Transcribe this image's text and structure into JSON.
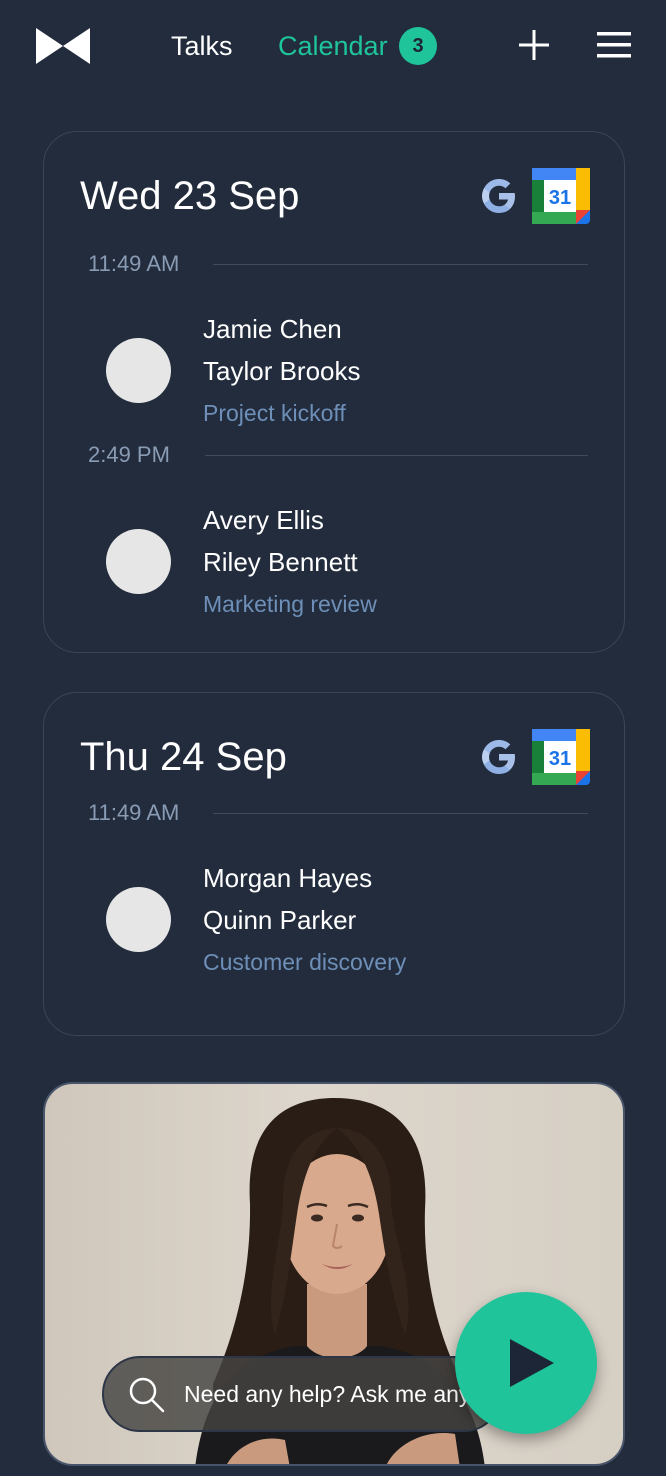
{
  "header": {
    "nav_talks": "Talks",
    "nav_calendar": "Calendar",
    "calendar_badge": "3",
    "logo_icon": "bowtie-logo-icon",
    "add_icon": "plus-icon",
    "menu_icon": "hamburger-menu-icon"
  },
  "days": [
    {
      "date": "Wed 23 Sep",
      "meetings": [
        {
          "time": "11:49 AM",
          "people": [
            "Jamie Chen",
            "Taylor Brooks"
          ],
          "title": "Project kickoff"
        },
        {
          "time": "2:49 PM",
          "people": [
            "Avery Ellis",
            "Riley Bennett"
          ],
          "title": "Marketing review"
        }
      ]
    },
    {
      "date": "Thu 24 Sep",
      "meetings": [
        {
          "time": "11:49 AM",
          "people": [
            "Morgan Hayes",
            "Quinn Parker"
          ],
          "title": "Customer discovery"
        }
      ]
    }
  ],
  "calendar_icon_number": "31",
  "assistant": {
    "search_placeholder": "Need any help? Ask me anything",
    "play_icon": "play-icon"
  },
  "colors": {
    "background": "#222c3d",
    "accent": "#1fc49a",
    "muted_text": "#8a9bb4",
    "meeting_title": "#6e8fb8"
  }
}
